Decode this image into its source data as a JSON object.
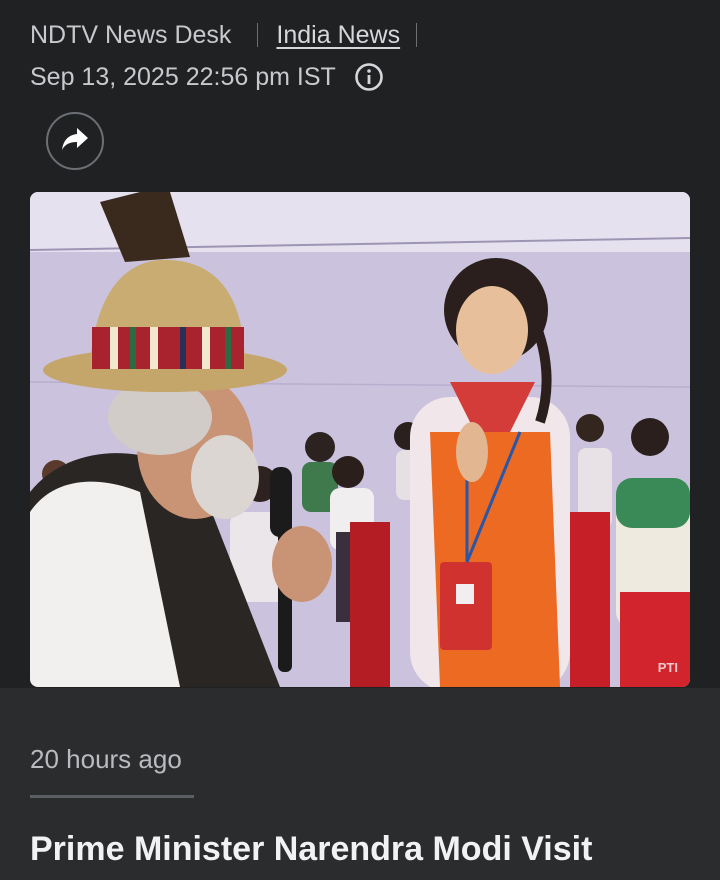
{
  "article": {
    "author": "NDTV News Desk",
    "category": "India News",
    "timestamp": "Sep 13, 2025 22:56 pm IST",
    "photo_credit": "PTI",
    "time_ago": "20 hours ago",
    "headline": "Prime Minister Narendra Modi Visit"
  },
  "icons": {
    "info": "info-icon",
    "share": "share-icon"
  },
  "colors": {
    "background": "#1f2123",
    "secondary_background": "#2a2c2e",
    "text_muted": "#c7c9cc",
    "headline": "#f1f2f3"
  }
}
